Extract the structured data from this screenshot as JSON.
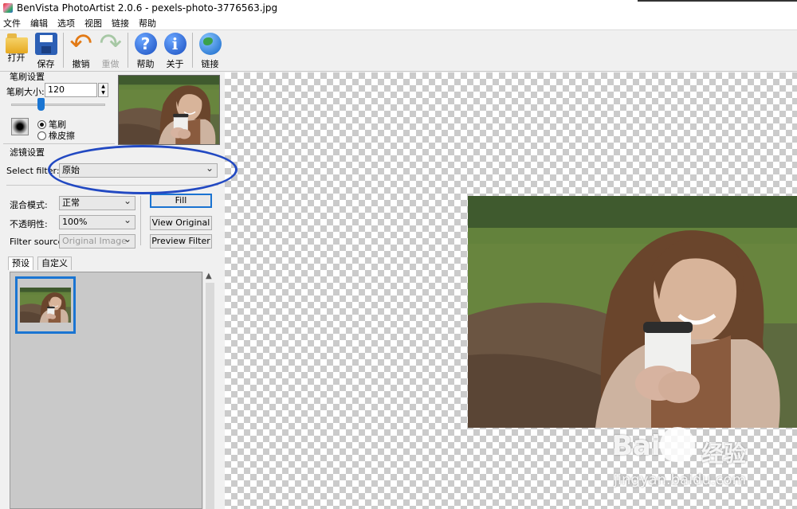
{
  "window": {
    "title": "BenVista PhotoArtist 2.0.6 - pexels-photo-3776563.jpg"
  },
  "menu": [
    "文件",
    "编辑",
    "选项",
    "视图",
    "链接",
    "帮助"
  ],
  "toolbar": {
    "open": "打开",
    "save": "保存",
    "undo": "撤销",
    "redo": "重做",
    "help": "帮助",
    "about": "关于",
    "link": "链接"
  },
  "brush": {
    "group_label": "笔刷设置",
    "size_label": "笔刷大小:",
    "size_value": "120",
    "size_fraction": 0.32,
    "radio_brush": "笔刷",
    "radio_eraser": "橡皮擦"
  },
  "filter": {
    "group_label": "滤镜设置",
    "select_label": "Select filter:",
    "select_value": "原始",
    "blend_label": "混合模式:",
    "blend_value": "正常",
    "opacity_label": "不透明性:",
    "opacity_value": "100%",
    "source_label": "Filter source:",
    "source_value": "Original Image",
    "fill_button": "Fill",
    "view_original_button": "View Original",
    "preview_filter_button": "Preview Filter"
  },
  "tabs": {
    "preset": "预设",
    "custom": "自定义"
  },
  "watermark": {
    "logo": "Bai",
    "cn": "经验",
    "url": "jingyan.baidu.com"
  },
  "colors": {
    "accent": "#1a75d2",
    "annotation": "#2249c2"
  }
}
